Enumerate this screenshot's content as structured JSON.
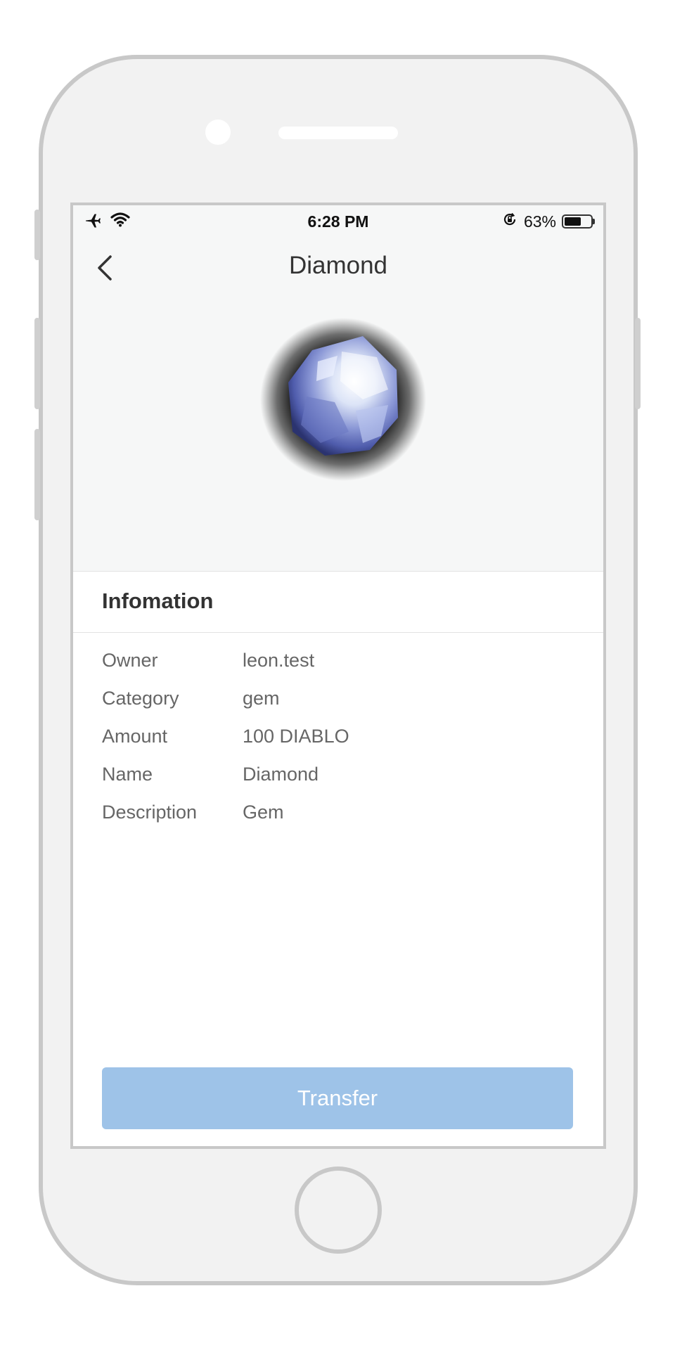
{
  "statusbar": {
    "time": "6:28 PM",
    "battery": "63%",
    "battery_level": 0.63,
    "icons": [
      "airplane-icon",
      "wifi-icon",
      "rotation-lock-icon",
      "battery-icon"
    ]
  },
  "navbar": {
    "title": "Diamond",
    "back_icon": "chevron-left-icon"
  },
  "item_image": "diamond-gem-image",
  "info": {
    "title": "Infomation",
    "rows": [
      {
        "label": "Owner",
        "value": "leon.test"
      },
      {
        "label": "Category",
        "value": "gem"
      },
      {
        "label": "Amount",
        "value": "100 DIABLO"
      },
      {
        "label": "Name",
        "value": "Diamond"
      },
      {
        "label": "Description",
        "value": "Gem"
      }
    ]
  },
  "actions": {
    "transfer_label": "Transfer"
  },
  "colors": {
    "button": "#9ec3e8",
    "header_bg": "#f6f7f7",
    "text_primary": "#333333",
    "text_secondary": "#666666"
  }
}
